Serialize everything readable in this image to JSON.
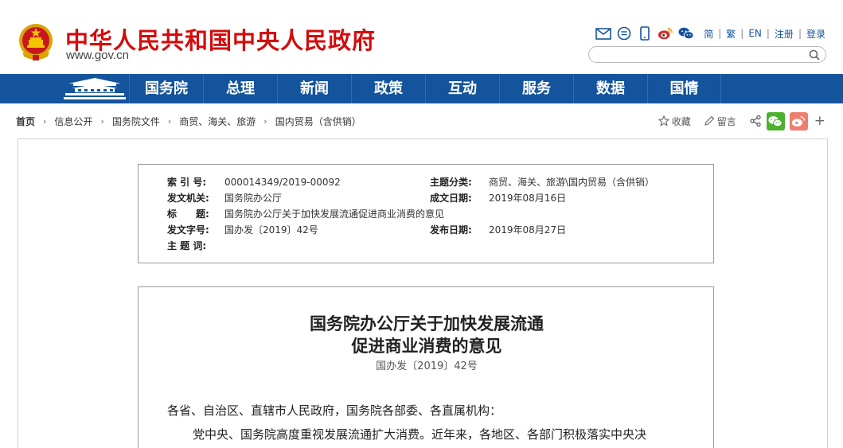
{
  "header": {
    "site_title": "中华人民共和国中央人民政府",
    "site_url": "www.gov.cn",
    "icons": [
      "mail-icon",
      "message-icon",
      "mobile-icon",
      "weibo-icon",
      "wechat-icon"
    ],
    "links": [
      "简",
      "繁",
      "EN",
      "注册",
      "登录"
    ],
    "search_placeholder": ""
  },
  "nav": {
    "items": [
      "国务院",
      "总理",
      "新闻",
      "政策",
      "互动",
      "服务",
      "数据",
      "国情"
    ]
  },
  "breadcrumb": {
    "items": [
      "首页",
      "信息公开",
      "国务院文件",
      "商贸、海关、旅游",
      "国内贸易（含供销）"
    ]
  },
  "actions": {
    "favorite": "收藏",
    "comment": "留言"
  },
  "meta": {
    "index_no_label": "索 引 号:",
    "index_no": "000014349/2019-00092",
    "category_label": "主题分类:",
    "category": "商贸、海关、旅游\\国内贸易（含供销）",
    "issuer_label": "发文机关:",
    "issuer": "国务院办公厅",
    "date_written_label": "成文日期:",
    "date_written": "2019年08月16日",
    "title_label": "标　　题:",
    "title": "国务院办公厅关于加快发展流通促进商业消费的意见",
    "doc_no_label": "发文字号:",
    "doc_no": "国办发〔2019〕42号",
    "publish_date_label": "发布日期:",
    "publish_date": "2019年08月27日",
    "keywords_label": "主 题 词:",
    "keywords": ""
  },
  "article": {
    "title_line1": "国务院办公厅关于加快发展流通",
    "title_line2": "促进商业消费的意见",
    "number": "国办发〔2019〕42号",
    "salutation": "各省、自治区、直辖市人民政府，国务院各部委、各直属机构：",
    "paragraph1": "党中央、国务院高度重视发展流通扩大消费。近年来，各地区、各部门积极落实中央决"
  },
  "colors": {
    "brand_red": "#d30c0c",
    "nav_blue": "#14549c",
    "wechat_green": "#4cb130",
    "weibo_orange": "#f07e6e"
  }
}
